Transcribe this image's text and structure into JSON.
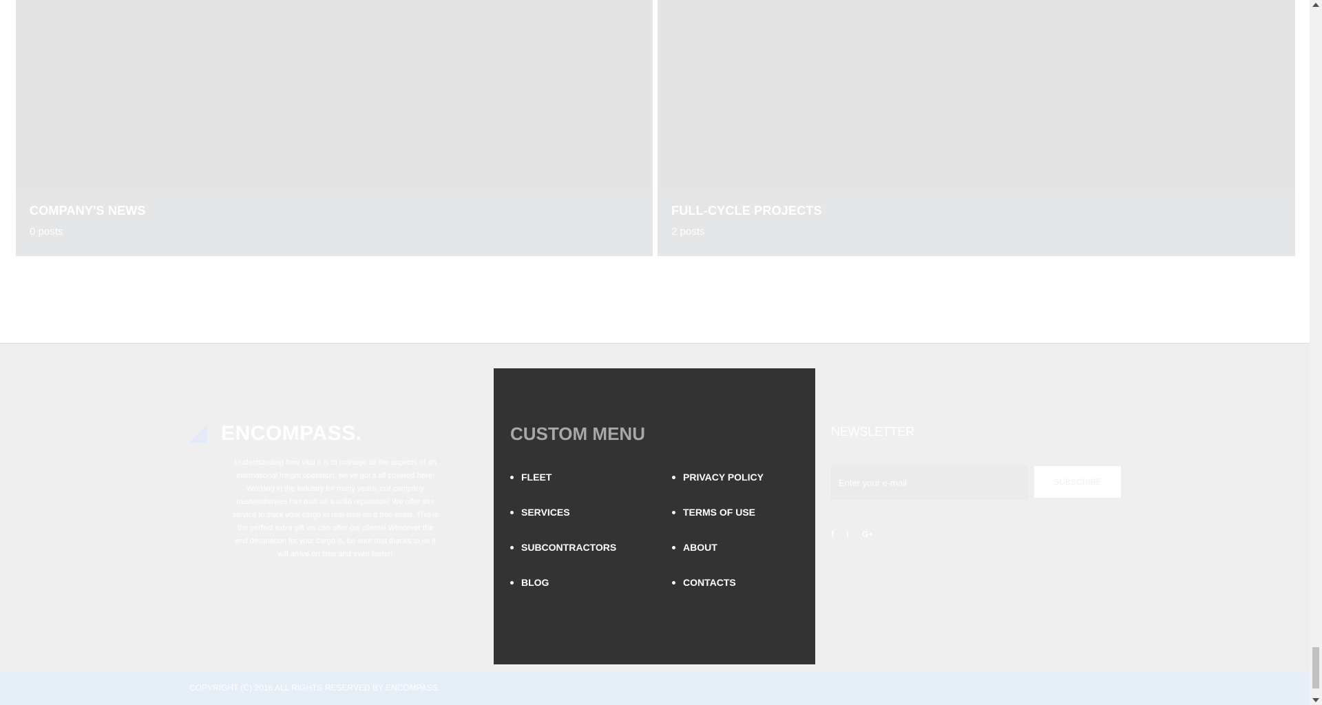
{
  "categories": [
    {
      "title": "COMPANY'S NEWS",
      "count": "0 posts"
    },
    {
      "title": "FULL-CYCLE PROJECTS",
      "count": "2 posts"
    }
  ],
  "footer": {
    "logo_text": "ENCOMPASS.",
    "about_text": "Understanding how vital it is to manage all the aspects of an international freight operation, we've got it all covered here! Working in the industry for many years, our company trustworthiness has built us a solid reputation! We offer this service to track your cargo in real-time on a free basis. This is the perfect extra gift we can offer our clients! Whatever the end destination for your cargo is, be sure that thanks to us it will arrive on time and even faster!",
    "menu": {
      "title": "CUSTOM MENU",
      "left": [
        "FLEET",
        "SERVICES",
        "SUBCONTRACTORS",
        "BLOG"
      ],
      "right": [
        "PRIVACY POLICY",
        "TERMS OF USE",
        "ABOUT",
        "CONTACTS"
      ]
    },
    "newsletter": {
      "title": "NEWSLETTER",
      "placeholder": "Enter your e-mail",
      "button": "SUBSCRIBE"
    },
    "social": [
      {
        "icon": "facebook-icon",
        "glyph": "f"
      },
      {
        "icon": "twitter-icon",
        "glyph": "t"
      },
      {
        "icon": "google-plus-icon",
        "glyph": "G+"
      }
    ],
    "copyright": "COPYRIGHT (C) 2016 ALL RIGHTS RESERVED BY ENCOMPASS."
  }
}
